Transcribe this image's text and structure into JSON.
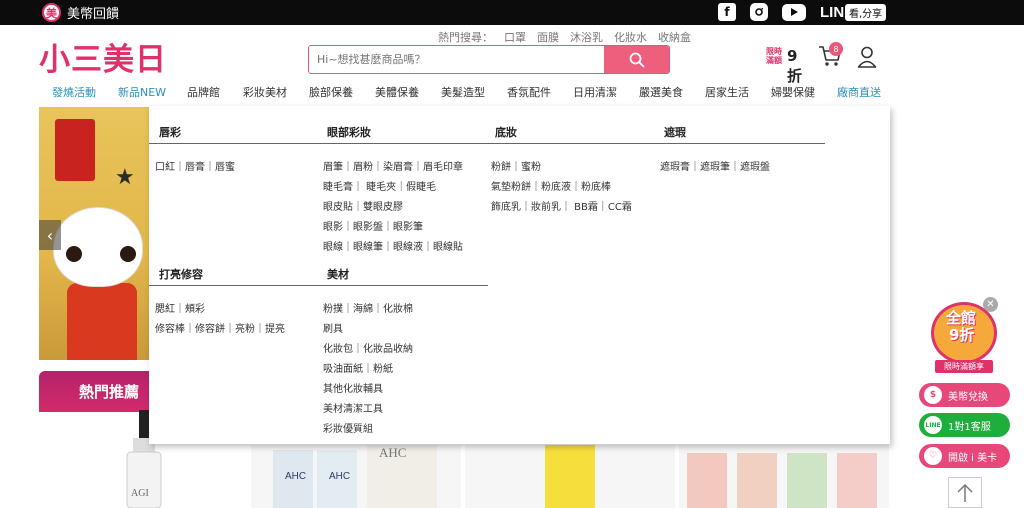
{
  "topbar": {
    "coin_badge": "美",
    "coin_label": "美幣回饋",
    "social": [
      "facebook-icon",
      "instagram-icon",
      "youtube-icon"
    ],
    "line_label": "LINE",
    "share_label": "看,分享"
  },
  "header": {
    "logo": "小三美日",
    "hot_label": "熱門搜尋：",
    "hot_terms": [
      "口罩",
      "面膜",
      "沐浴乳",
      "化妝水",
      "收納盒"
    ],
    "search_placeholder": "Hi~想找甚麼商品嗎？",
    "promo_top": "限時",
    "promo_bottom": "滿額",
    "promo_big": "9折",
    "cart_count": "8"
  },
  "nav": {
    "items": [
      "發燒活動",
      "新品NEW",
      "品牌館",
      "彩妝美材",
      "臉部保養",
      "美體保養",
      "美髮造型",
      "香氛配件",
      "日用清潔",
      "嚴選美食",
      "居家生活",
      "婦嬰保健",
      "廠商直送"
    ]
  },
  "banner": {
    "hot_title": "熱門推薦"
  },
  "mega": {
    "lips": {
      "title": "唇彩",
      "items": [
        "口紅｜唇膏｜唇蜜"
      ]
    },
    "eyes": {
      "title": "眼部彩妝",
      "items": [
        "眉筆｜眉粉｜染眉膏｜眉毛印章",
        "睫毛膏｜ 睫毛夾｜假睫毛",
        "眼皮貼｜雙眼皮膠",
        "眼影｜眼影盤｜眼影筆",
        "眼線｜眼線筆｜眼線液｜眼線貼"
      ]
    },
    "base": {
      "title": "底妝",
      "items": [
        "粉餅｜蜜粉",
        "氣墊粉餅｜粉底液｜粉底棒",
        "飾底乳｜妝前乳｜ BB霜｜CC霜"
      ]
    },
    "conceal": {
      "title": "遮瑕",
      "items": [
        "遮瑕膏｜遮瑕筆｜遮瑕盤"
      ]
    },
    "highlight": {
      "title": "打亮修容",
      "items": [
        "腮紅｜頰彩",
        "修容棒｜修容餅｜亮粉｜提亮"
      ]
    },
    "tools": {
      "title": "美材",
      "items": [
        "粉撲｜海綿｜化妝棉",
        "刷具",
        "化妝包｜化妝品收納",
        "吸油面紙｜粉紙",
        "其他化妝輔具",
        "美材清潔工具",
        "彩妝優質組"
      ]
    }
  },
  "side": {
    "promo_line1": "全館",
    "promo_line2": "9折",
    "promo_bar": "限時滿額享",
    "btn_coin": "美幣兌換",
    "btn_line": "1對1客服",
    "btn_line_icon": "LINE",
    "btn_card": "開啟 i 美卡",
    "colors": {
      "pink": "#e8477a",
      "green": "#1fad3c"
    }
  }
}
